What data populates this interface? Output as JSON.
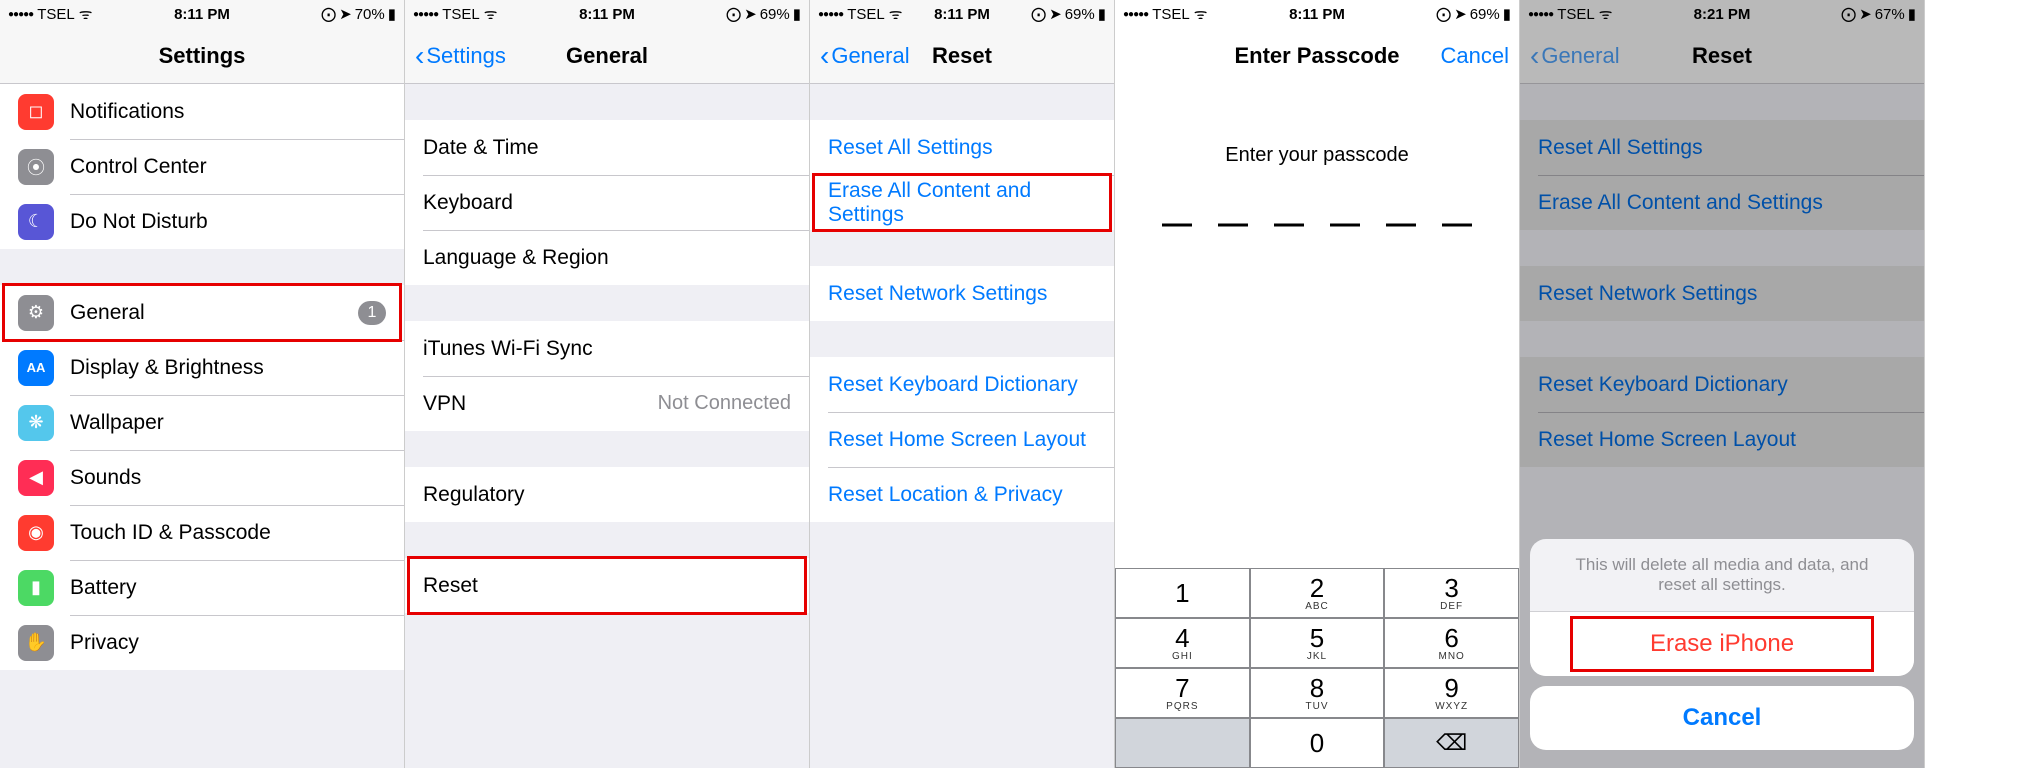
{
  "statusbars": [
    {
      "carrier": "TSEL",
      "time": "8:11 PM",
      "battery": "70%"
    },
    {
      "carrier": "TSEL",
      "time": "8:11 PM",
      "battery": "69%"
    },
    {
      "carrier": "TSEL",
      "time": "8:11 PM",
      "battery": "69%"
    },
    {
      "carrier": "TSEL",
      "time": "8:11 PM",
      "battery": "69%"
    },
    {
      "carrier": "TSEL",
      "time": "8:21 PM",
      "battery": "67%"
    }
  ],
  "screen1": {
    "title": "Settings",
    "items": [
      {
        "label": "Notifications",
        "iconColor": "#ff3b30",
        "glyph": "◻︎"
      },
      {
        "label": "Control Center",
        "iconColor": "#8e8e93",
        "glyph": "⦿"
      },
      {
        "label": "Do Not Disturb",
        "iconColor": "#5856d6",
        "glyph": "☾"
      }
    ],
    "items2": [
      {
        "label": "General",
        "iconColor": "#8e8e93",
        "glyph": "⚙",
        "badge": "1"
      },
      {
        "label": "Display & Brightness",
        "iconColor": "#007aff",
        "glyph": "AA"
      },
      {
        "label": "Wallpaper",
        "iconColor": "#54c7ec",
        "glyph": "❋"
      },
      {
        "label": "Sounds",
        "iconColor": "#ff2d55",
        "glyph": "🔊"
      },
      {
        "label": "Touch ID & Passcode",
        "iconColor": "#ff3b30",
        "glyph": "◉"
      },
      {
        "label": "Battery",
        "iconColor": "#4cd964",
        "glyph": "▮"
      },
      {
        "label": "Privacy",
        "iconColor": "#8e8e93",
        "glyph": "✋"
      }
    ]
  },
  "screen2": {
    "back": "Settings",
    "title": "General",
    "groupA": [
      "Date & Time",
      "Keyboard",
      "Language & Region"
    ],
    "groupB": [
      {
        "label": "iTunes Wi-Fi Sync",
        "value": ""
      },
      {
        "label": "VPN",
        "value": "Not Connected"
      }
    ],
    "groupC": [
      "Regulatory"
    ],
    "groupD": [
      "Reset"
    ]
  },
  "screen3": {
    "back": "General",
    "title": "Reset",
    "groupA": [
      "Reset All Settings",
      "Erase All Content and Settings"
    ],
    "groupB": [
      "Reset Network Settings"
    ],
    "groupC": [
      "Reset Keyboard Dictionary",
      "Reset Home Screen Layout",
      "Reset Location & Privacy"
    ]
  },
  "screen4": {
    "title": "Enter Passcode",
    "cancel": "Cancel",
    "prompt": "Enter your passcode",
    "keys": [
      {
        "n": "1",
        "l": ""
      },
      {
        "n": "2",
        "l": "ABC"
      },
      {
        "n": "3",
        "l": "DEF"
      },
      {
        "n": "4",
        "l": "GHI"
      },
      {
        "n": "5",
        "l": "JKL"
      },
      {
        "n": "6",
        "l": "MNO"
      },
      {
        "n": "7",
        "l": "PQRS"
      },
      {
        "n": "8",
        "l": "TUV"
      },
      {
        "n": "9",
        "l": "WXYZ"
      }
    ],
    "zero": "0"
  },
  "screen5": {
    "back": "General",
    "title": "Reset",
    "groupA": [
      "Reset All Settings",
      "Erase All Content and Settings"
    ],
    "groupB": [
      "Reset Network Settings"
    ],
    "groupC": [
      "Reset Keyboard Dictionary",
      "Reset Home Screen Layout"
    ],
    "sheetMsg": "This will delete all media and data, and reset all settings.",
    "erase": "Erase iPhone",
    "cancel": "Cancel"
  }
}
